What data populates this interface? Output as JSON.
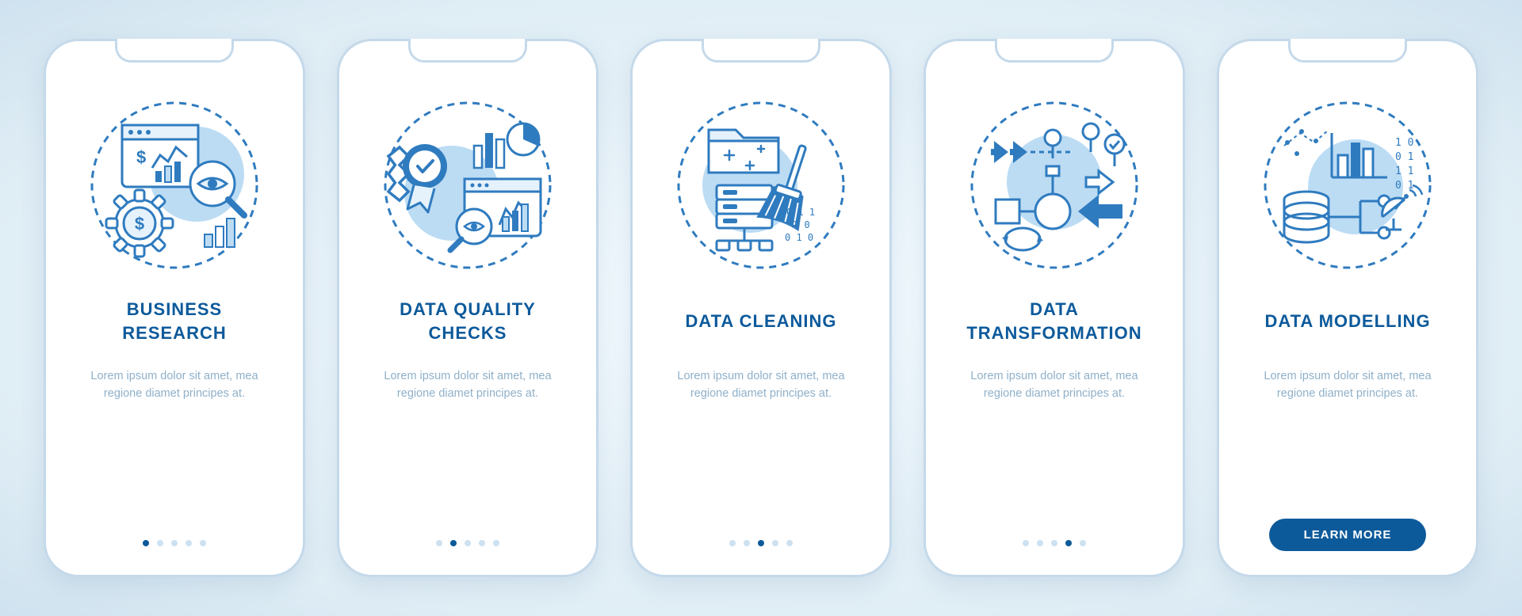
{
  "colors": {
    "primary": "#0d5a9b",
    "accent_light": "#9ecbee",
    "text_muted": "#8fb0c9"
  },
  "lorem": "Lorem ipsum dolor sit amet, mea regione diamet principes at.",
  "cta_label": "LEARN MORE",
  "screens": [
    {
      "title": "BUSINESS\nRESEARCH",
      "icon": "business-research-icon",
      "active_dot": 0
    },
    {
      "title": "DATA QUALITY\nCHECKS",
      "icon": "data-quality-icon",
      "active_dot": 1
    },
    {
      "title": "DATA CLEANING",
      "icon": "data-cleaning-icon",
      "active_dot": 2
    },
    {
      "title": "DATA\nTRANSFORMATION",
      "icon": "data-transformation-icon",
      "active_dot": 3
    },
    {
      "title": "DATA MODELLING",
      "icon": "data-modelling-icon",
      "active_dot": 4
    }
  ]
}
